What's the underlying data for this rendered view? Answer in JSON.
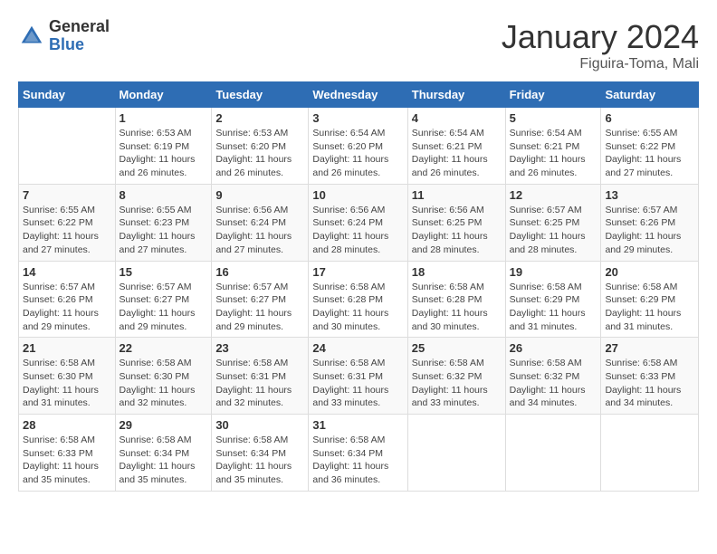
{
  "logo": {
    "general": "General",
    "blue": "Blue"
  },
  "title": "January 2024",
  "location": "Figuira-Toma, Mali",
  "weekdays": [
    "Sunday",
    "Monday",
    "Tuesday",
    "Wednesday",
    "Thursday",
    "Friday",
    "Saturday"
  ],
  "weeks": [
    [
      {
        "day": "",
        "sunrise": "",
        "sunset": "",
        "daylight": ""
      },
      {
        "day": "1",
        "sunrise": "Sunrise: 6:53 AM",
        "sunset": "Sunset: 6:19 PM",
        "daylight": "Daylight: 11 hours and 26 minutes."
      },
      {
        "day": "2",
        "sunrise": "Sunrise: 6:53 AM",
        "sunset": "Sunset: 6:20 PM",
        "daylight": "Daylight: 11 hours and 26 minutes."
      },
      {
        "day": "3",
        "sunrise": "Sunrise: 6:54 AM",
        "sunset": "Sunset: 6:20 PM",
        "daylight": "Daylight: 11 hours and 26 minutes."
      },
      {
        "day": "4",
        "sunrise": "Sunrise: 6:54 AM",
        "sunset": "Sunset: 6:21 PM",
        "daylight": "Daylight: 11 hours and 26 minutes."
      },
      {
        "day": "5",
        "sunrise": "Sunrise: 6:54 AM",
        "sunset": "Sunset: 6:21 PM",
        "daylight": "Daylight: 11 hours and 26 minutes."
      },
      {
        "day": "6",
        "sunrise": "Sunrise: 6:55 AM",
        "sunset": "Sunset: 6:22 PM",
        "daylight": "Daylight: 11 hours and 27 minutes."
      }
    ],
    [
      {
        "day": "7",
        "sunrise": "Sunrise: 6:55 AM",
        "sunset": "Sunset: 6:22 PM",
        "daylight": "Daylight: 11 hours and 27 minutes."
      },
      {
        "day": "8",
        "sunrise": "Sunrise: 6:55 AM",
        "sunset": "Sunset: 6:23 PM",
        "daylight": "Daylight: 11 hours and 27 minutes."
      },
      {
        "day": "9",
        "sunrise": "Sunrise: 6:56 AM",
        "sunset": "Sunset: 6:24 PM",
        "daylight": "Daylight: 11 hours and 27 minutes."
      },
      {
        "day": "10",
        "sunrise": "Sunrise: 6:56 AM",
        "sunset": "Sunset: 6:24 PM",
        "daylight": "Daylight: 11 hours and 28 minutes."
      },
      {
        "day": "11",
        "sunrise": "Sunrise: 6:56 AM",
        "sunset": "Sunset: 6:25 PM",
        "daylight": "Daylight: 11 hours and 28 minutes."
      },
      {
        "day": "12",
        "sunrise": "Sunrise: 6:57 AM",
        "sunset": "Sunset: 6:25 PM",
        "daylight": "Daylight: 11 hours and 28 minutes."
      },
      {
        "day": "13",
        "sunrise": "Sunrise: 6:57 AM",
        "sunset": "Sunset: 6:26 PM",
        "daylight": "Daylight: 11 hours and 29 minutes."
      }
    ],
    [
      {
        "day": "14",
        "sunrise": "Sunrise: 6:57 AM",
        "sunset": "Sunset: 6:26 PM",
        "daylight": "Daylight: 11 hours and 29 minutes."
      },
      {
        "day": "15",
        "sunrise": "Sunrise: 6:57 AM",
        "sunset": "Sunset: 6:27 PM",
        "daylight": "Daylight: 11 hours and 29 minutes."
      },
      {
        "day": "16",
        "sunrise": "Sunrise: 6:57 AM",
        "sunset": "Sunset: 6:27 PM",
        "daylight": "Daylight: 11 hours and 29 minutes."
      },
      {
        "day": "17",
        "sunrise": "Sunrise: 6:58 AM",
        "sunset": "Sunset: 6:28 PM",
        "daylight": "Daylight: 11 hours and 30 minutes."
      },
      {
        "day": "18",
        "sunrise": "Sunrise: 6:58 AM",
        "sunset": "Sunset: 6:28 PM",
        "daylight": "Daylight: 11 hours and 30 minutes."
      },
      {
        "day": "19",
        "sunrise": "Sunrise: 6:58 AM",
        "sunset": "Sunset: 6:29 PM",
        "daylight": "Daylight: 11 hours and 31 minutes."
      },
      {
        "day": "20",
        "sunrise": "Sunrise: 6:58 AM",
        "sunset": "Sunset: 6:29 PM",
        "daylight": "Daylight: 11 hours and 31 minutes."
      }
    ],
    [
      {
        "day": "21",
        "sunrise": "Sunrise: 6:58 AM",
        "sunset": "Sunset: 6:30 PM",
        "daylight": "Daylight: 11 hours and 31 minutes."
      },
      {
        "day": "22",
        "sunrise": "Sunrise: 6:58 AM",
        "sunset": "Sunset: 6:30 PM",
        "daylight": "Daylight: 11 hours and 32 minutes."
      },
      {
        "day": "23",
        "sunrise": "Sunrise: 6:58 AM",
        "sunset": "Sunset: 6:31 PM",
        "daylight": "Daylight: 11 hours and 32 minutes."
      },
      {
        "day": "24",
        "sunrise": "Sunrise: 6:58 AM",
        "sunset": "Sunset: 6:31 PM",
        "daylight": "Daylight: 11 hours and 33 minutes."
      },
      {
        "day": "25",
        "sunrise": "Sunrise: 6:58 AM",
        "sunset": "Sunset: 6:32 PM",
        "daylight": "Daylight: 11 hours and 33 minutes."
      },
      {
        "day": "26",
        "sunrise": "Sunrise: 6:58 AM",
        "sunset": "Sunset: 6:32 PM",
        "daylight": "Daylight: 11 hours and 34 minutes."
      },
      {
        "day": "27",
        "sunrise": "Sunrise: 6:58 AM",
        "sunset": "Sunset: 6:33 PM",
        "daylight": "Daylight: 11 hours and 34 minutes."
      }
    ],
    [
      {
        "day": "28",
        "sunrise": "Sunrise: 6:58 AM",
        "sunset": "Sunset: 6:33 PM",
        "daylight": "Daylight: 11 hours and 35 minutes."
      },
      {
        "day": "29",
        "sunrise": "Sunrise: 6:58 AM",
        "sunset": "Sunset: 6:34 PM",
        "daylight": "Daylight: 11 hours and 35 minutes."
      },
      {
        "day": "30",
        "sunrise": "Sunrise: 6:58 AM",
        "sunset": "Sunset: 6:34 PM",
        "daylight": "Daylight: 11 hours and 35 minutes."
      },
      {
        "day": "31",
        "sunrise": "Sunrise: 6:58 AM",
        "sunset": "Sunset: 6:34 PM",
        "daylight": "Daylight: 11 hours and 36 minutes."
      },
      {
        "day": "",
        "sunrise": "",
        "sunset": "",
        "daylight": ""
      },
      {
        "day": "",
        "sunrise": "",
        "sunset": "",
        "daylight": ""
      },
      {
        "day": "",
        "sunrise": "",
        "sunset": "",
        "daylight": ""
      }
    ]
  ]
}
